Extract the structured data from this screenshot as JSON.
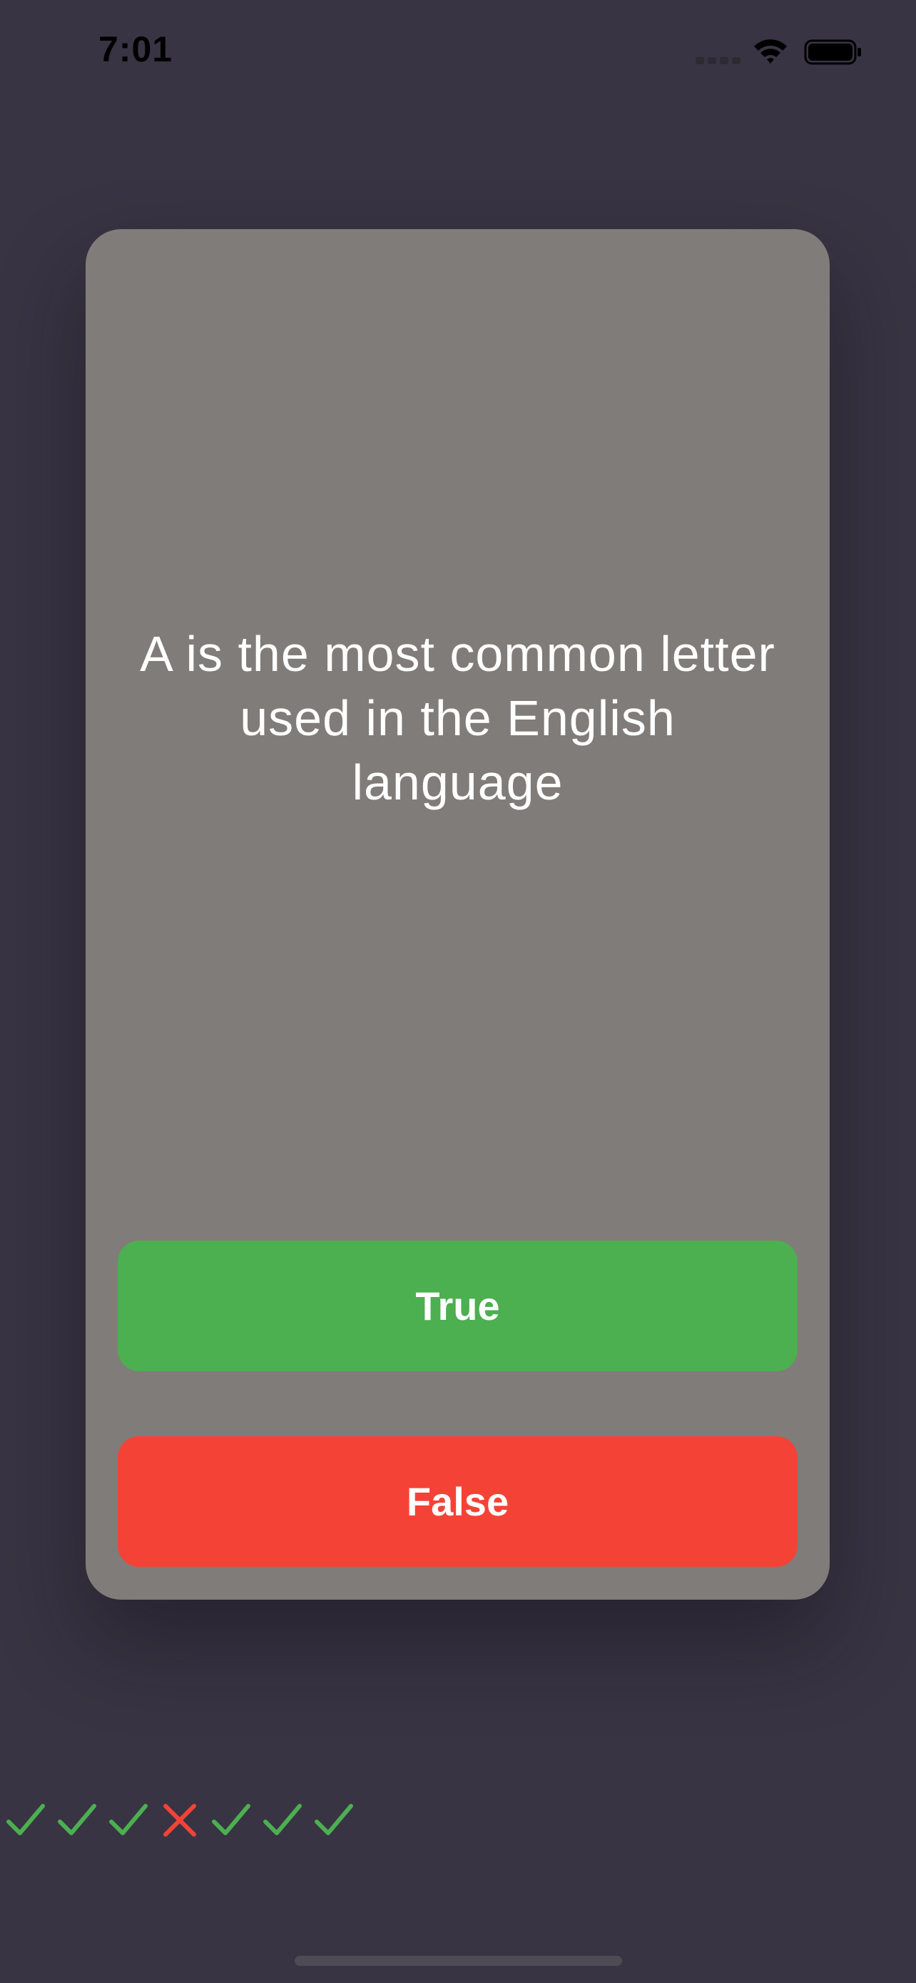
{
  "status_bar": {
    "time": "7:01"
  },
  "question": {
    "text": "A is the most common letter used in the English language"
  },
  "answers": {
    "true_label": "True",
    "false_label": "False"
  },
  "score_keeper": {
    "results": [
      "correct",
      "correct",
      "correct",
      "wrong",
      "correct",
      "correct",
      "correct"
    ]
  },
  "colors": {
    "background": "#383443",
    "card": "#807c79",
    "true_button": "#4caf50",
    "false_button": "#f44336",
    "correct_mark": "#4caf50",
    "wrong_mark": "#f44336"
  },
  "icons": {
    "correct": "check-icon",
    "wrong": "close-icon"
  }
}
